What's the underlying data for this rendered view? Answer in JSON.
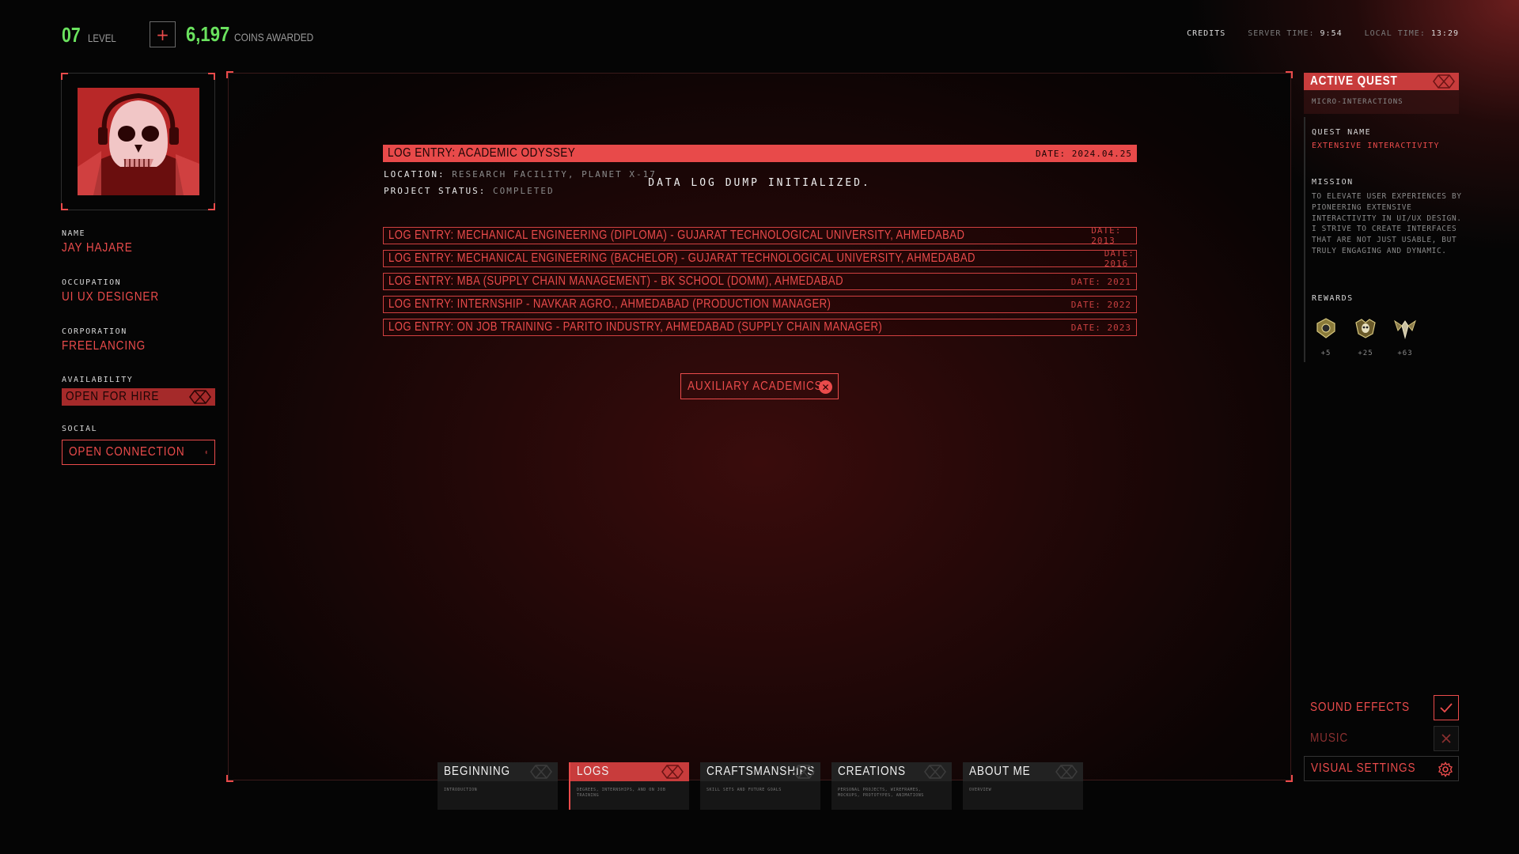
{
  "header": {
    "level_value": "07",
    "level_label": "LEVEL",
    "plus_label": "+",
    "coins_value": "6,197",
    "coins_label": "COINS AWARDED",
    "credits": "CREDITS",
    "server_time_label": "SERVER TIME:",
    "server_time": "9:54",
    "local_time_label": "LOCAL TIME:",
    "local_time": "13:29"
  },
  "profile": {
    "name_label": "NAME",
    "name": "JAY HAJARE",
    "occupation_label": "OCCUPATION",
    "occupation": "UI UX DESIGNER",
    "corporation_label": "CORPORATION",
    "corporation": "FREELANCING",
    "availability_label": "AVAILABILITY",
    "availability": "OPEN FOR HIRE",
    "social_label": "SOCIAL",
    "social_button": "OPEN CONNECTION"
  },
  "main": {
    "status_line": "DATA LOG DUMP INITIALIZED.",
    "featured": {
      "title": "LOG ENTRY: ACADEMIC ODYSSEY",
      "date": "DATE: 2024.04.25",
      "location_label": "LOCATION:",
      "location": "RESEARCH FACILITY, PLANET X-17",
      "status_label": "PROJECT STATUS:",
      "status": "COMPLETED"
    },
    "entries": [
      {
        "title": "LOG ENTRY: MECHANICAL ENGINEERING (DIPLOMA) - GUJARAT TECHNOLOGICAL UNIVERSITY, AHMEDABAD",
        "date": "DATE: 2013"
      },
      {
        "title": "LOG ENTRY: MECHANICAL ENGINEERING (BACHELOR) - GUJARAT TECHNOLOGICAL UNIVERSITY, AHMEDABAD",
        "date": "DATE: 2016"
      },
      {
        "title": "LOG ENTRY: MBA (SUPPLY CHAIN MANAGEMENT) - BK SCHOOL (DOMM), AHMEDABAD",
        "date": "DATE: 2021"
      },
      {
        "title": "LOG ENTRY: INTERNSHIP - NAVKAR AGRO., AHMEDABAD (PRODUCTION MANAGER)",
        "date": "DATE: 2022"
      },
      {
        "title": "LOG ENTRY:  ON JOB TRAINING - PARITO INDUSTRY, AHMEDABAD (SUPPLY CHAIN MANAGER)",
        "date": "DATE: 2023"
      }
    ],
    "aux_button": "AUXILIARY ACADEMICS"
  },
  "tabs": [
    {
      "label": "BEGINNING",
      "sub": "INTRODUCTION",
      "active": false
    },
    {
      "label": "LOGS",
      "sub": "DEGREES, INTERNSHIPS, AND ON JOB TRAINING",
      "active": true
    },
    {
      "label": "CRAFTSMANSHIPS",
      "sub": "SKILL SETS AND FUTURE GOALS",
      "active": false
    },
    {
      "label": "CREATIONS",
      "sub": "PERSONAL PROJECTS, WIREFRAMES, MOCKUPS, PROTOTYPES, ANIMATIONS",
      "active": false
    },
    {
      "label": "ABOUT ME",
      "sub": "OVERVIEW",
      "active": false
    }
  ],
  "quest": {
    "header": "ACTIVE QUEST",
    "subtitle": "MICRO-INTERACTIONS",
    "name_label": "QUEST NAME",
    "name": "EXTENSIVE INTERACTIVITY",
    "mission_label": "MISSION",
    "mission": "TO ELEVATE USER EXPERIENCES BY PIONEERING EXTENSIVE INTERACTIVITY IN UI/UX DESIGN. I STRIVE TO CREATE INTERFACES THAT ARE NOT JUST USABLE, BUT TRULY ENGAGING AND DYNAMIC.",
    "rewards_label": "REWARDS",
    "rewards": [
      {
        "icon": "emblem-icon",
        "value": "+5"
      },
      {
        "icon": "skull-emblem-icon",
        "value": "+25"
      },
      {
        "icon": "wings-emblem-icon",
        "value": "+63"
      }
    ]
  },
  "settings": [
    {
      "label": "SOUND EFFECTS",
      "state": "on",
      "icon": "check-icon"
    },
    {
      "label": "MUSIC",
      "state": "off",
      "icon": "close-icon"
    },
    {
      "label": "VISUAL SETTINGS",
      "state": "open",
      "icon": "gear-icon"
    }
  ],
  "colors": {
    "accent": "#ea4b4b",
    "accent_dark": "#c83c3c",
    "positive": "#6ae25e",
    "background": "#050505"
  }
}
